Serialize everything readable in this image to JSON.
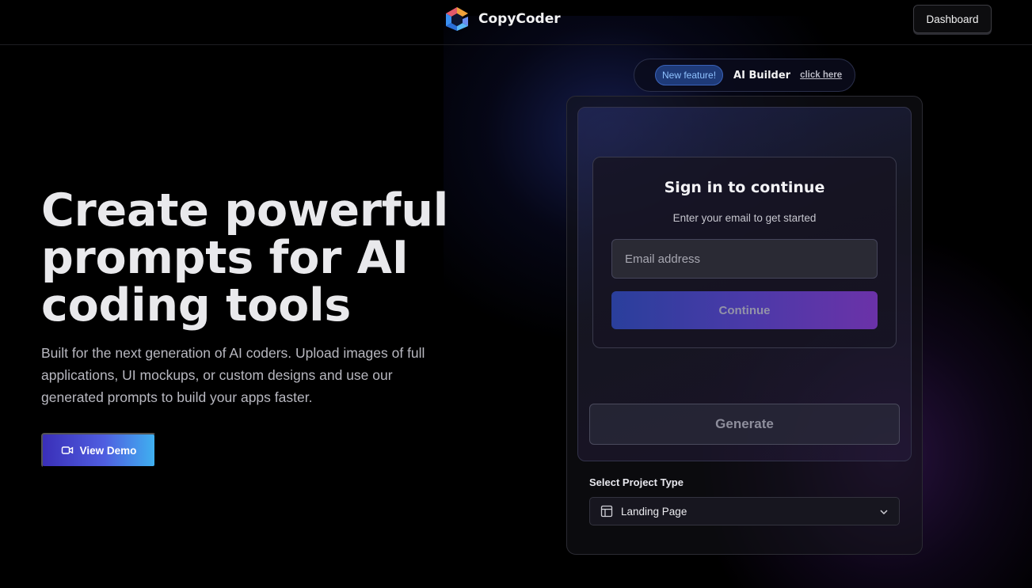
{
  "header": {
    "brand_name": "CopyCoder",
    "dashboard_label": "Dashboard"
  },
  "hero": {
    "title": "Create powerful prompts for AI coding tools",
    "subtitle": "Built for the next generation of AI coders. Upload images of full applications, UI mockups, or custom designs and use our generated prompts to build your apps faster.",
    "demo_button_label": "View Demo",
    "demo_icon": "video-camera-icon"
  },
  "feature_pill": {
    "badge": "New feature!",
    "title": "AI Builder",
    "link": "click here"
  },
  "signin": {
    "title": "Sign in to continue",
    "subtitle": "Enter your email to get started",
    "email_placeholder": "Email address",
    "email_value": "",
    "continue_label": "Continue"
  },
  "generate_label": "Generate",
  "project_type": {
    "label": "Select Project Type",
    "selected": "Landing Page",
    "icon": "layout-template-icon"
  },
  "colors": {
    "background": "#000000",
    "accent_blue": "#3fb0f0",
    "accent_purple": "#6b32a8",
    "badge_text": "#8fc2ff"
  }
}
